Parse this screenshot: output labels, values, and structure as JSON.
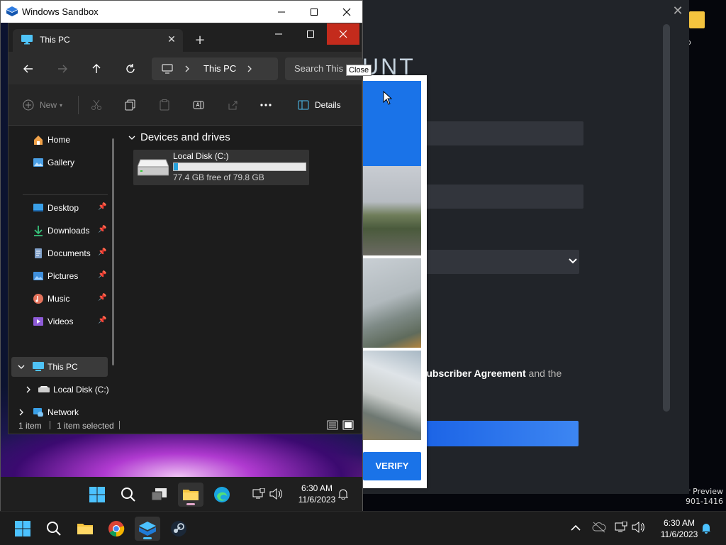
{
  "host": {
    "desktop_icon_label": "o",
    "watermark_line1": "r Preview",
    "watermark_line2": "901-1416",
    "clock_time": "6:30 AM",
    "clock_date": "11/6/2023"
  },
  "steam": {
    "heading_partial": "UNT",
    "agreement_prefix": "",
    "agreement_link": "Subscriber Agreement",
    "agreement_suffix": " and the"
  },
  "captcha": {
    "verify_label": "VERIFY"
  },
  "sandbox": {
    "title": "Windows Sandbox",
    "clock_time": "6:30 AM",
    "clock_date": "11/6/2023"
  },
  "explorer": {
    "tab_label": "This PC",
    "tooltip": "Close",
    "address_label": "This PC",
    "search_placeholder": "Search This PC",
    "cmd_new": "New",
    "cmd_details": "Details",
    "sidebar": {
      "home": "Home",
      "gallery": "Gallery",
      "desktop": "Desktop",
      "downloads": "Downloads",
      "documents": "Documents",
      "pictures": "Pictures",
      "music": "Music",
      "videos": "Videos",
      "this_pc": "This PC",
      "local_disk": "Local Disk (C:)",
      "network": "Network"
    },
    "group_header": "Devices and drives",
    "drive": {
      "name": "Local Disk (C:)",
      "free_text": "77.4 GB free of 79.8 GB",
      "used_fraction": 0.03
    },
    "status": {
      "items": "1 item",
      "selected": "1 item selected"
    }
  },
  "colors": {
    "accent_blue": "#1a73e8",
    "close_red": "#c42b1c",
    "drive_bar": "#26a0da"
  }
}
